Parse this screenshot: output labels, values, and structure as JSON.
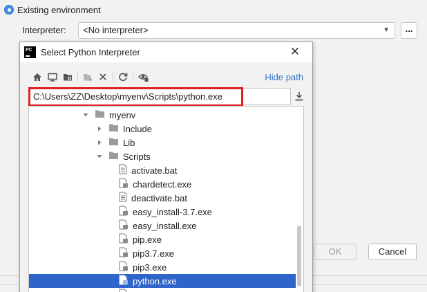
{
  "settings": {
    "env_radio_label": "Existing environment",
    "interpreter_label": "Interpreter:",
    "interpreter_value": "<No interpreter>",
    "browse_label": "...",
    "ok_label": "OK",
    "cancel_label": "Cancel"
  },
  "dialog": {
    "app_icon_text": "PC",
    "title": "Select Python Interpreter",
    "close_glyph": "✕",
    "hide_path_label": "Hide path",
    "path_value": "C:\\Users\\ZZ\\Desktop\\myenv\\Scripts\\python.exe",
    "toolbar_icons": [
      "home-icon",
      "desktop-icon",
      "project-folder-icon",
      "new-folder-icon",
      "delete-icon",
      "refresh-icon",
      "show-hidden-icon"
    ],
    "tree": {
      "myenv": "myenv",
      "include": "Include",
      "lib": "Lib",
      "scripts": "Scripts",
      "files": [
        "activate.bat",
        "chardetect.exe",
        "deactivate.bat",
        "easy_install-3.7.exe",
        "easy_install.exe",
        "pip.exe",
        "pip3.7.exe",
        "pip3.exe",
        "python.exe"
      ],
      "selected_file": "python.exe"
    }
  },
  "colors": {
    "accent": "#2f65ca",
    "link": "#2f6fc5",
    "highlight_border": "#e02020",
    "radio": "#3d8ee5"
  }
}
